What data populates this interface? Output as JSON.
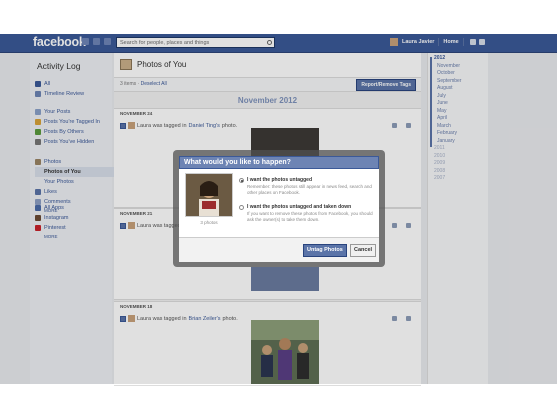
{
  "topbar": {
    "logo": "facebook",
    "search_placeholder": "Search for people, places and things",
    "user_name": "Laura Javier",
    "home_label": "Home"
  },
  "sidebar": {
    "title": "Activity Log",
    "groups": [
      [
        {
          "label": "All",
          "icon": "activity-icon",
          "color": "#3b5998"
        },
        {
          "label": "Timeline Review",
          "icon": "timeline-icon",
          "color": "#6d84b4"
        }
      ],
      [
        {
          "label": "Your Posts",
          "icon": "posts-icon",
          "color": "#8aa1c9"
        },
        {
          "label": "Posts You're Tagged In",
          "icon": "tag-icon",
          "color": "#d8a23a"
        },
        {
          "label": "Posts By Others",
          "icon": "others-icon",
          "color": "#5a9a3e"
        },
        {
          "label": "Posts You've Hidden",
          "icon": "hidden-icon",
          "color": "#777777"
        }
      ],
      [
        {
          "label": "Photos",
          "icon": "photos-icon",
          "color": "#9a8565"
        },
        {
          "label": "Photos of You",
          "icon": "",
          "selected": true
        },
        {
          "label": "Your Photos",
          "icon": ""
        },
        {
          "label": "Likes",
          "icon": "like-icon",
          "color": "#5b74a8"
        },
        {
          "label": "Comments",
          "icon": "comment-icon",
          "color": "#8c9fc4"
        }
      ],
      [
        {
          "label": "All Apps",
          "icon": "apps-icon",
          "color": "#4a6aa8"
        },
        {
          "label": "Instagram",
          "icon": "instagram-icon",
          "color": "#6b4b35"
        },
        {
          "label": "Pinterest",
          "icon": "pinterest-icon",
          "color": "#c8232c"
        }
      ]
    ],
    "more_label": "MORE"
  },
  "main": {
    "title": "Photos of You",
    "items_count": "3 items",
    "deselect_label": "Deselect All",
    "report_button": "Report/Remove Tags",
    "month_header": "November 2012",
    "sections": [
      {
        "date": "NOVEMBER 24",
        "actor": "Laura was tagged in",
        "link": "Daniel Ting's",
        "suffix": "photo."
      },
      {
        "date": "NOVEMBER 21",
        "actor": "Laura was tagged in",
        "link": "",
        "suffix": ""
      },
      {
        "date": "NOVEMBER 18",
        "actor": "Laura was tagged in",
        "link": "Brian Zeiler's",
        "suffix": "photo."
      }
    ]
  },
  "rail": {
    "years": [
      {
        "label": "2012",
        "current": true
      },
      {
        "label": "November",
        "month": true
      },
      {
        "label": "October",
        "month": true
      },
      {
        "label": "September",
        "month": true
      },
      {
        "label": "August",
        "month": true
      },
      {
        "label": "July",
        "month": true
      },
      {
        "label": "June",
        "month": true
      },
      {
        "label": "May",
        "month": true
      },
      {
        "label": "April",
        "month": true
      },
      {
        "label": "March",
        "month": true
      },
      {
        "label": "February",
        "month": true
      },
      {
        "label": "January",
        "month": true
      },
      {
        "label": "2011"
      },
      {
        "label": "2010"
      },
      {
        "label": "2009"
      },
      {
        "label": "2008"
      },
      {
        "label": "2007"
      }
    ]
  },
  "dialog": {
    "title": "What would you like to happen?",
    "thumb_caption": "3 photos",
    "option1_label": "I want the photos untagged",
    "option1_desc": "Remember: these photos still appear in news feed, search and other places on Facebook.",
    "option2_label": "I want the photos untagged and taken down",
    "option2_desc": "If you want to remove these photos from Facebook, you should ask the owner(s) to take them down.",
    "untag_button": "Untag Photos",
    "cancel_button": "Cancel"
  },
  "colors": {
    "brand": "#3b5998",
    "dialog_header": "#6d84b4"
  }
}
